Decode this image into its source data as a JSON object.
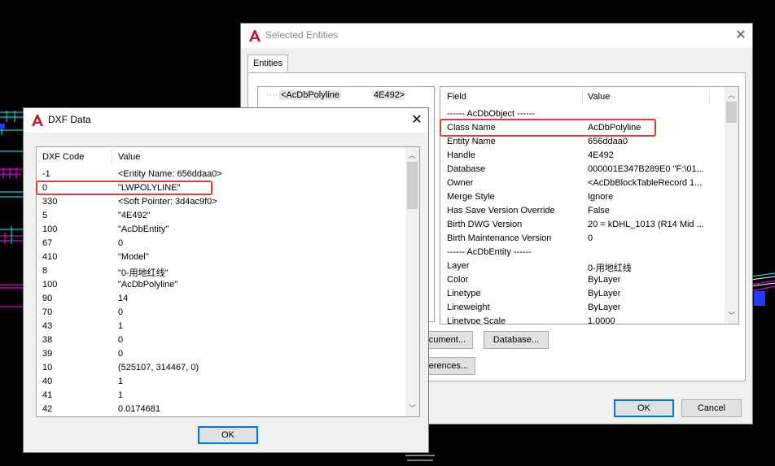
{
  "selected_entities": {
    "title": "Selected Entities",
    "tab_label": "Entities",
    "tree_item": {
      "name": "<AcDbPolyline",
      "handle": "4E492>"
    },
    "columns": {
      "field": "Field",
      "value": "Value"
    },
    "rows": [
      {
        "field": "------ AcDbObject ------",
        "value": ""
      },
      {
        "field": "Class Name",
        "value": "AcDbPolyline"
      },
      {
        "field": "Entity Name",
        "value": "656ddaa0"
      },
      {
        "field": "Handle",
        "value": "4E492"
      },
      {
        "field": "Database",
        "value": "000001E347B289E0  \"F:\\01..."
      },
      {
        "field": "Owner",
        "value": "<AcDbBlockTableRecord 1..."
      },
      {
        "field": "Merge Style",
        "value": "Ignore"
      },
      {
        "field": "Has Save Version Override",
        "value": "False"
      },
      {
        "field": "Birth DWG Version",
        "value": "20 = kDHL_1013  (R14 Mid ..."
      },
      {
        "field": "Birth Maintenance Version",
        "value": "0"
      },
      {
        "field": "------ AcDbEntity ------",
        "value": ""
      },
      {
        "field": "Layer",
        "value": "0-用地红线"
      },
      {
        "field": "Color",
        "value": "ByLayer"
      },
      {
        "field": "Linetype",
        "value": "ByLayer"
      },
      {
        "field": "Lineweight",
        "value": "ByLayer"
      },
      {
        "field": "Linetype Scale",
        "value": "1.0000"
      }
    ],
    "buttons": {
      "document": "ocument...",
      "database": "Database...",
      "references": "erences...",
      "ok": "OK",
      "cancel": "Cancel"
    }
  },
  "dxf_data": {
    "title": "DXF Data",
    "columns": {
      "code": "DXF Code",
      "value": "Value"
    },
    "rows": [
      {
        "code": "-1",
        "value": "<Entity Name: 656ddaa0>"
      },
      {
        "code": "0",
        "value": "\"LWPOLYLINE\""
      },
      {
        "code": "330",
        "value": "<Soft Pointer: 3d4ac9f0>"
      },
      {
        "code": "5",
        "value": "\"4E492\""
      },
      {
        "code": "100",
        "value": "\"AcDbEntity\""
      },
      {
        "code": "67",
        "value": "0"
      },
      {
        "code": "410",
        "value": "\"Model\""
      },
      {
        "code": "8",
        "value": "\"0-用地红线\""
      },
      {
        "code": "100",
        "value": "\"AcDbPolyline\""
      },
      {
        "code": "90",
        "value": "14"
      },
      {
        "code": "70",
        "value": "0"
      },
      {
        "code": "43",
        "value": "1"
      },
      {
        "code": "38",
        "value": "0"
      },
      {
        "code": "39",
        "value": "0"
      },
      {
        "code": "10",
        "value": "(525107, 314467, 0)"
      },
      {
        "code": "40",
        "value": "1"
      },
      {
        "code": "41",
        "value": "1"
      },
      {
        "code": "42",
        "value": "0.0174681"
      }
    ],
    "ok_label": "OK"
  },
  "colors": {
    "highlight": "#e03c31",
    "autocad_red": "#c8102e",
    "cad_magenta": "#ff00ff",
    "cad_cyan": "#00ffff",
    "cad_blue": "#1f3cff"
  },
  "icons": {
    "app": "autocad-logo-icon",
    "close": "close-icon",
    "scroll_up": "chevron-up-icon",
    "scroll_down": "chevron-down-icon"
  }
}
